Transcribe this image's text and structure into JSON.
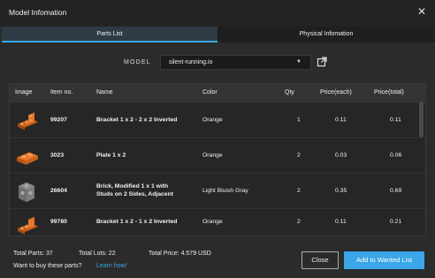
{
  "window": {
    "title": "Model Infomation"
  },
  "tabs": [
    {
      "label": "Parts List",
      "active": true
    },
    {
      "label": "Physical Infomation",
      "active": false
    }
  ],
  "model": {
    "label": "MODEL",
    "selected": "silent-running.io"
  },
  "table": {
    "headers": [
      "Image",
      "Item no.",
      "Name",
      "Color",
      "Qty",
      "Price(each)",
      "Price(total)"
    ],
    "rows": [
      {
        "item_no": "99207",
        "name_line1": "Bracket 1 x 2 - 2 x 2 Inverted",
        "name_line2": "",
        "color": "Orange",
        "qty": "1",
        "price_each": "0.11",
        "price_total": "0.11",
        "thumb": "orange-bracket-icon"
      },
      {
        "item_no": "3023",
        "name_line1": "Plate 1 x 2",
        "name_line2": "",
        "color": "Orange",
        "qty": "2",
        "price_each": "0.03",
        "price_total": "0.06",
        "thumb": "orange-plate-icon"
      },
      {
        "item_no": "26604",
        "name_line1": "Brick, Modified 1 x 1 with",
        "name_line2": "Studs on 2 Sides, Adjacent",
        "color": "Light Bluish Gray",
        "qty": "2",
        "price_each": "0.35",
        "price_total": "0.69",
        "thumb": "gray-brick-icon"
      },
      {
        "item_no": "99780",
        "name_line1": "Bracket 1 x 2 - 1 x 2 Inverted",
        "name_line2": "",
        "color": "Orange",
        "qty": "2",
        "price_each": "0.11",
        "price_total": "0.21",
        "thumb": "orange-bracket-icon"
      }
    ]
  },
  "footer": {
    "total_parts": "Total Parts: 37",
    "total_lots": "Total Lots: 22",
    "total_price": "Total Price: 4.579 USD",
    "buy_prompt": "Want to buy these parts?",
    "learn_link": "Learn how!",
    "close_label": "Close",
    "add_label": "Add to Wanted List"
  },
  "colors": {
    "accent": "#3aa6e8",
    "part_orange": "#e8772a",
    "part_gray": "#8c8c8c"
  }
}
